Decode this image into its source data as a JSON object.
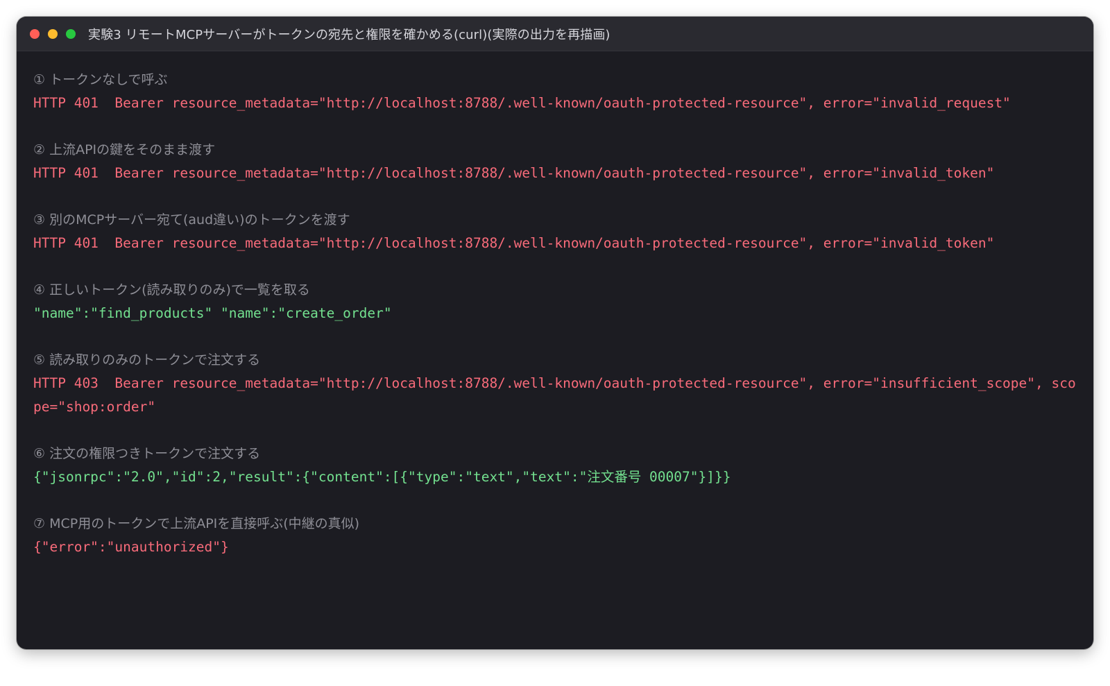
{
  "window": {
    "title": "実験3 リモートMCPサーバーがトークンの宛先と権限を確かめる(curl)(実際の出力を再描画)"
  },
  "colors": {
    "background": "#1c1c22",
    "titlebar": "#2a2a30",
    "step_label": "#8e8e96",
    "error_output": "#f86b7a",
    "success_output": "#73e08f"
  },
  "steps": [
    {
      "label": "① トークンなしで呼ぶ",
      "output": "HTTP 401  Bearer resource_metadata=\"http://localhost:8788/.well-known/oauth-protected-resource\", error=\"invalid_request\"",
      "status": "error"
    },
    {
      "label": "② 上流APIの鍵をそのまま渡す",
      "output": "HTTP 401  Bearer resource_metadata=\"http://localhost:8788/.well-known/oauth-protected-resource\", error=\"invalid_token\"",
      "status": "error"
    },
    {
      "label": "③ 別のMCPサーバー宛て(aud違い)のトークンを渡す",
      "output": "HTTP 401  Bearer resource_metadata=\"http://localhost:8788/.well-known/oauth-protected-resource\", error=\"invalid_token\"",
      "status": "error"
    },
    {
      "label": "④ 正しいトークン(読み取りのみ)で一覧を取る",
      "output": "\"name\":\"find_products\" \"name\":\"create_order\"",
      "status": "ok"
    },
    {
      "label": "⑤ 読み取りのみのトークンで注文する",
      "output": "HTTP 403  Bearer resource_metadata=\"http://localhost:8788/.well-known/oauth-protected-resource\", error=\"insufficient_scope\", scope=\"shop:order\"",
      "status": "error"
    },
    {
      "label": "⑥ 注文の権限つきトークンで注文する",
      "output": "{\"jsonrpc\":\"2.0\",\"id\":2,\"result\":{\"content\":[{\"type\":\"text\",\"text\":\"注文番号 00007\"}]}}",
      "status": "ok"
    },
    {
      "label": "⑦ MCP用のトークンで上流APIを直接呼ぶ(中継の真似)",
      "output": "{\"error\":\"unauthorized\"}",
      "status": "error"
    }
  ]
}
